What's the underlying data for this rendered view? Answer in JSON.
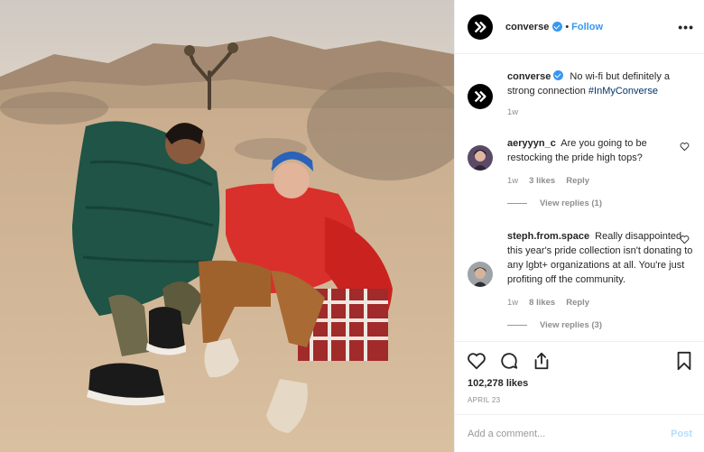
{
  "post": {
    "image_alt": "Two people sitting on desert sand wrapped in sleeping bags",
    "account": "converse",
    "follow_label": "Follow",
    "dot": "•",
    "more_label": "•••"
  },
  "caption": {
    "user": "converse",
    "text": "No wi-fi but definitely a strong connection",
    "hashtag": "#InMyConverse",
    "time": "1w"
  },
  "comments": [
    {
      "user": "aeryyyn_c",
      "text": "Are you going to be restocking the pride high tops?",
      "time": "1w",
      "likes": "3 likes",
      "reply": "Reply",
      "view_replies": "View replies (1)"
    },
    {
      "user": "steph.from.space",
      "text": "Really disappointed this year's pride collection isn't donating to any lgbt+ organizations at all. You're just profiting off the community.",
      "time": "1w",
      "likes": "8 likes",
      "reply": "Reply",
      "view_replies": "View replies (3)"
    }
  ],
  "footer": {
    "likes": "102,278 likes",
    "date": "APRIL 23",
    "comment_placeholder": "Add a comment...",
    "post_label": "Post"
  },
  "colors": {
    "accent": "#3897f0",
    "hashtag": "#003569",
    "muted": "#8e8e8e",
    "post_disabled": "#b2dffc"
  },
  "icons": [
    "converse-logo-icon",
    "verified-icon",
    "heart-icon",
    "comment-icon",
    "share-icon",
    "bookmark-icon"
  ]
}
